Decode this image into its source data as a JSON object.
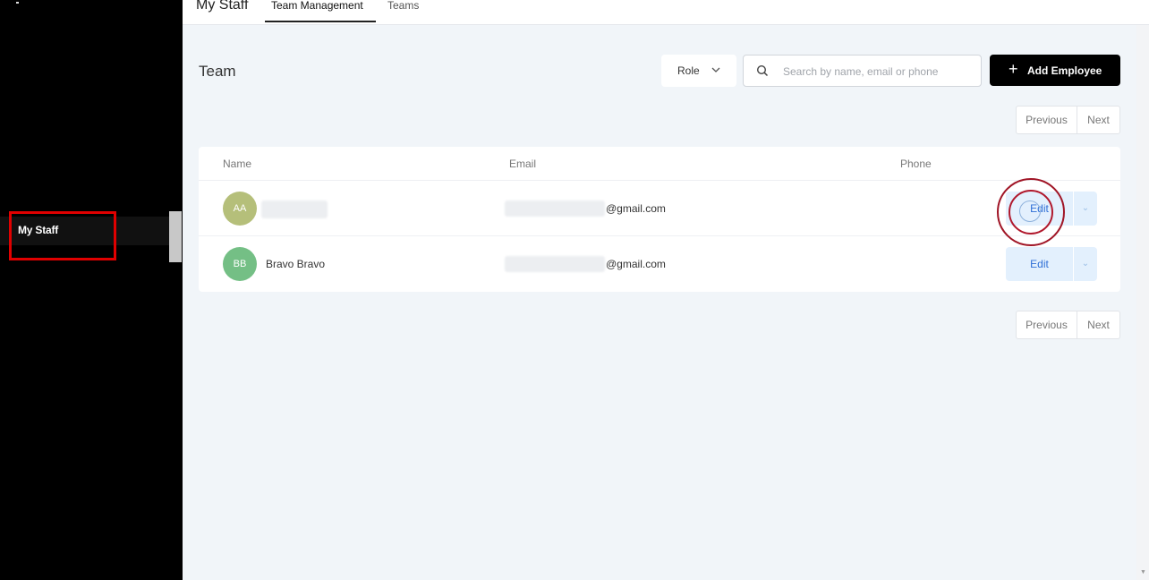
{
  "header": {
    "page_title": "My Staff",
    "tabs": [
      {
        "label": "Team Management",
        "active": true
      },
      {
        "label": "Teams",
        "active": false
      }
    ]
  },
  "sidebar": {
    "items": [
      {
        "label": "My Staff",
        "active": true
      }
    ],
    "highlight_color": "#e00000"
  },
  "main": {
    "title": "Team",
    "role_filter": {
      "label": "Role",
      "icon": "chevron-down-icon"
    },
    "search": {
      "placeholder": "Search by name, email or phone",
      "value": "",
      "icon": "search-icon"
    },
    "add_button": {
      "label": "Add Employee",
      "icon": "plus-icon"
    },
    "pagination": {
      "previous": "Previous",
      "next": "Next"
    },
    "table": {
      "columns": [
        "Name",
        "Email",
        "Phone"
      ],
      "rows": [
        {
          "initials": "AA",
          "avatar_color": "#b5bf7a",
          "name": "",
          "email_domain": "@gmail.com",
          "phone": "",
          "action": "Edit"
        },
        {
          "initials": "BB",
          "avatar_color": "#74bf85",
          "name": "Bravo Bravo",
          "email_domain": "@gmail.com",
          "phone": "",
          "action": "Edit"
        }
      ]
    }
  },
  "colors": {
    "accent": "#000000",
    "edit_button_bg": "#e3f0fd",
    "edit_button_text": "#2f6fd6",
    "click_indicator": "#a01526"
  }
}
